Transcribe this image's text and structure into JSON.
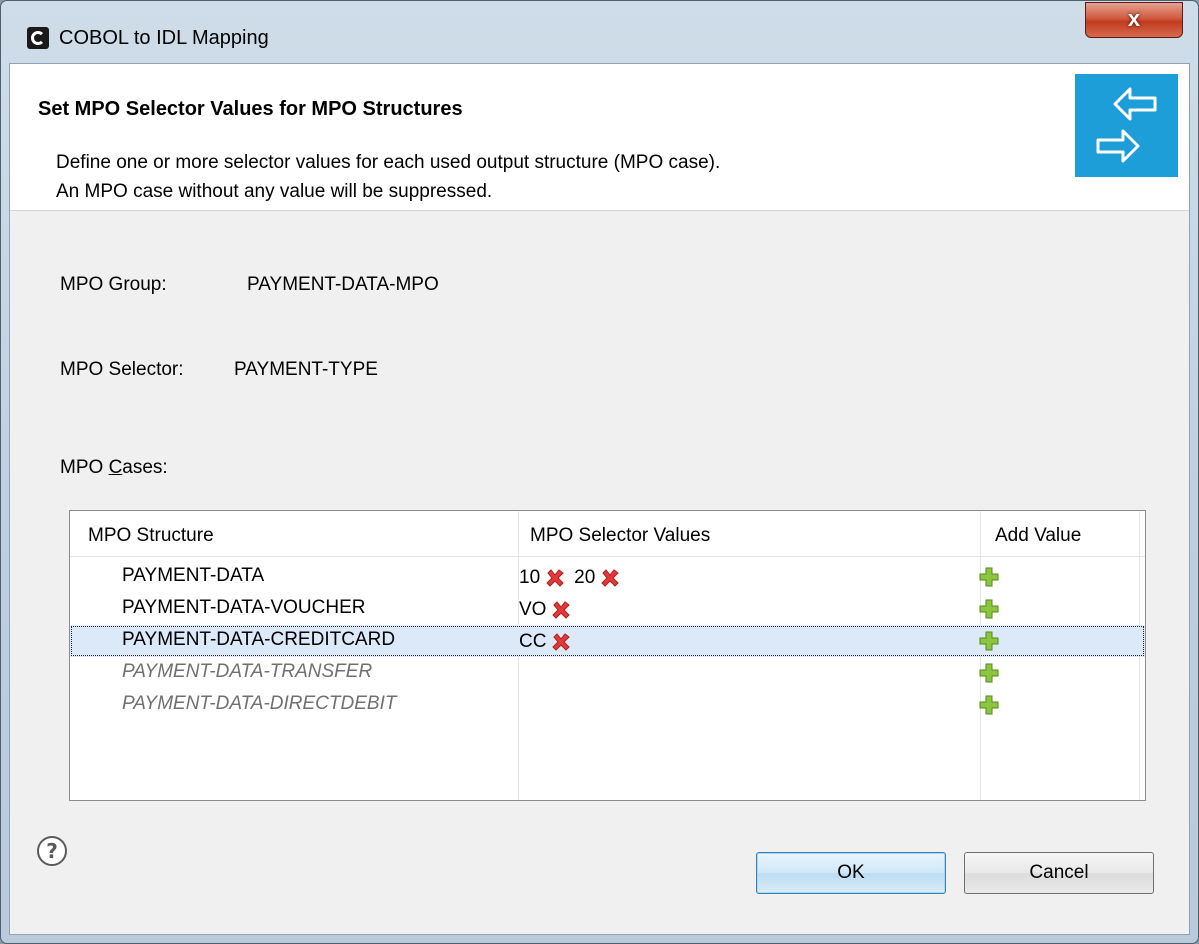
{
  "window": {
    "title": "COBOL to IDL Mapping",
    "close_label": "x"
  },
  "header": {
    "title": "Set MPO Selector Values for MPO Structures",
    "description_line1": "Define one or more selector values for each used output structure (MPO case).",
    "description_line2": "An MPO case without any value will be suppressed.",
    "badge_icon": "swap-arrows-icon",
    "badge_color": "#1e9ed8"
  },
  "form": {
    "group_label": "MPO Group:",
    "group_value": "PAYMENT-DATA-MPO",
    "selector_label": "MPO Selector:",
    "selector_value": "PAYMENT-TYPE",
    "cases_label_prefix": "MPO ",
    "cases_label_mnemonic": "C",
    "cases_label_rest": "ases:"
  },
  "table": {
    "columns": [
      "MPO Structure",
      "MPO Selector Values",
      "Add Value"
    ],
    "rows": [
      {
        "structure": "PAYMENT-DATA",
        "values": [
          "10",
          "20"
        ],
        "used": true,
        "selected": false
      },
      {
        "structure": "PAYMENT-DATA-VOUCHER",
        "values": [
          "VO"
        ],
        "used": true,
        "selected": false
      },
      {
        "structure": "PAYMENT-DATA-CREDITCARD",
        "values": [
          "CC"
        ],
        "used": true,
        "selected": true
      },
      {
        "structure": "PAYMENT-DATA-TRANSFER",
        "values": [],
        "used": false,
        "selected": false
      },
      {
        "structure": "PAYMENT-DATA-DIRECTDEBIT",
        "values": [],
        "used": false,
        "selected": false
      }
    ],
    "delete_icon": "red-x-icon",
    "add_icon": "green-plus-icon"
  },
  "footer": {
    "help_icon": "help-icon",
    "ok_label": "OK",
    "cancel_label": "Cancel"
  }
}
